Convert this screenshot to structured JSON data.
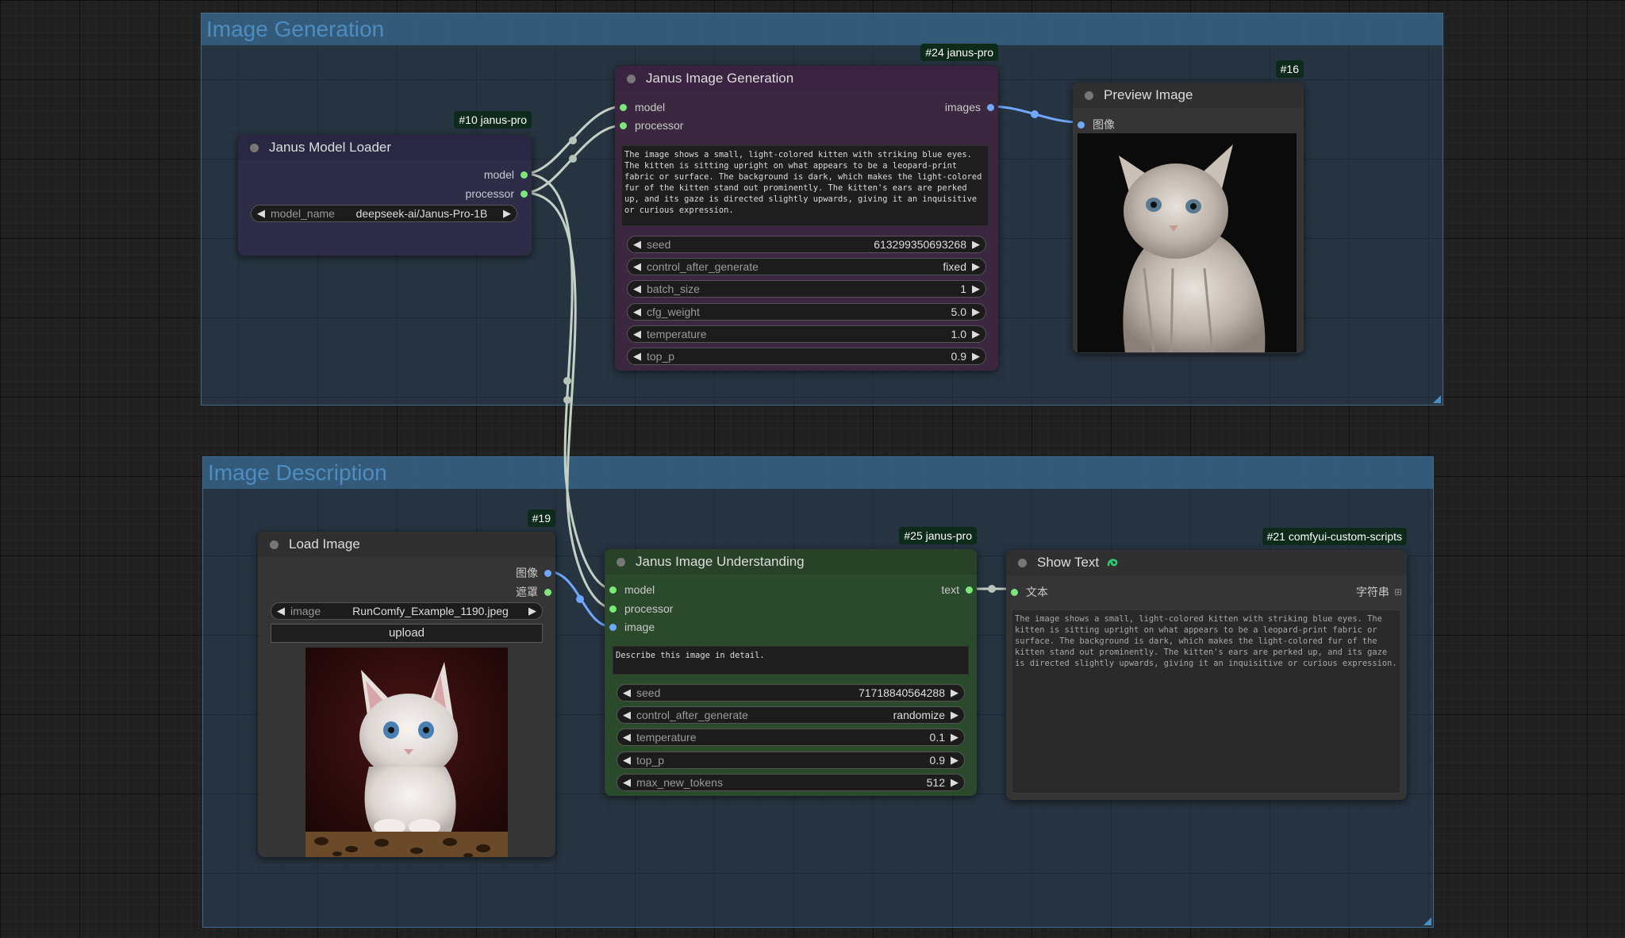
{
  "groups": {
    "generation": {
      "title": "Image Generation"
    },
    "description": {
      "title": "Image Description"
    }
  },
  "nodes": {
    "model_loader": {
      "badge": "#10 janus-pro",
      "title": "Janus Model Loader",
      "outputs": {
        "model": "model",
        "processor": "processor"
      },
      "widget": {
        "label": "model_name",
        "value": "deepseek-ai/Janus-Pro-1B"
      }
    },
    "image_generation": {
      "badge": "#24 janus-pro",
      "title": "Janus Image Generation",
      "inputs": {
        "model": "model",
        "processor": "processor"
      },
      "output": "images",
      "prompt": "The image shows a small, light-colored kitten with striking blue eyes. The kitten is sitting upright on what appears to be a leopard-print fabric or surface. The background is dark, which makes the light-colored fur of the kitten stand out prominently. The kitten's ears are perked up, and its gaze is directed slightly upwards, giving it an inquisitive or curious expression.",
      "widgets": [
        {
          "label": "seed",
          "value": "613299350693268"
        },
        {
          "label": "control_after_generate",
          "value": "fixed"
        },
        {
          "label": "batch_size",
          "value": "1"
        },
        {
          "label": "cfg_weight",
          "value": "5.0"
        },
        {
          "label": "temperature",
          "value": "1.0"
        },
        {
          "label": "top_p",
          "value": "0.9"
        }
      ]
    },
    "preview_image": {
      "badge": "#16",
      "title": "Preview Image",
      "input": "图像"
    },
    "load_image": {
      "badge": "#19",
      "title": "Load Image",
      "outputs": {
        "image": "图像",
        "mask": "遮罩"
      },
      "widget": {
        "label": "image",
        "value": "RunComfy_Example_1190.jpeg"
      },
      "upload": "upload"
    },
    "image_understanding": {
      "badge": "#25 janus-pro",
      "title": "Janus Image Understanding",
      "inputs": {
        "model": "model",
        "processor": "processor",
        "image": "image"
      },
      "output": "text",
      "question": "Describe this image in detail.",
      "widgets": [
        {
          "label": "seed",
          "value": "717188405642​88"
        },
        {
          "label": "control_after_generate",
          "value": "randomize"
        },
        {
          "label": "temperature",
          "value": "0.1"
        },
        {
          "label": "top_p",
          "value": "0.9"
        },
        {
          "label": "max_new_tokens",
          "value": "512"
        }
      ]
    },
    "show_text": {
      "badge": "#21 comfyui-custom-scripts",
      "title": "Show Text",
      "input": "文本",
      "output": "字符串",
      "text": "The image shows a small, light-colored kitten with striking blue eyes. The kitten is sitting upright on what appears to be a leopard-print fabric or surface. The background is dark, which makes the light-colored fur of the kitten stand out prominently. The kitten's ears are perked up, and its gaze is directed slightly upwards, giving it an inquisitive or curious expression."
    }
  },
  "icons": {
    "left_arrow": "◀",
    "right_arrow": "▶",
    "python_icon": "snake-icon",
    "grid_icon": "⊞"
  },
  "colors": {
    "model_loader": "#2f2c48",
    "generation": "#3c2740",
    "understanding": "#2b4a2b",
    "generic_node": "#353535",
    "link_model": "#c8d4c8",
    "link_image": "#70a8ff"
  }
}
